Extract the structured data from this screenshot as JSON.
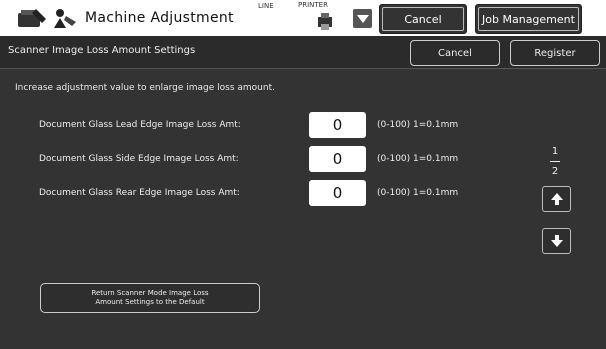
{
  "topbar": {
    "title": "Machine Adjustment",
    "line_label": "LINE",
    "printer_label": "PRINTER",
    "cancel_label": "Cancel",
    "job_management_label": "Job Management"
  },
  "header": {
    "title": "Scanner Image Loss Amount Settings",
    "cancel_label": "Cancel",
    "register_label": "Register"
  },
  "description": "Increase adjustment value to enlarge image loss amount.",
  "settings": [
    {
      "label": "Document Glass Lead Edge Image Loss Amt:",
      "value": "0",
      "range": "(0-100) 1=0.1mm"
    },
    {
      "label": "Document Glass Side Edge Image Loss Amt:",
      "value": "0",
      "range": "(0-100) 1=0.1mm"
    },
    {
      "label": "Document Glass Rear Edge Image Loss Amt:",
      "value": "0",
      "range": "(0-100) 1=0.1mm"
    }
  ],
  "pager": {
    "current": "1",
    "total": "2"
  },
  "default_button": {
    "line1": "Return Scanner Mode Image Loss",
    "line2": "Amount Settings to the Default"
  },
  "icons": {
    "machine": "machine-settings-icon",
    "adjust": "adjustment-person-icon",
    "printer": "printer-icon",
    "up": "arrow-up-icon",
    "down": "arrow-down-icon"
  }
}
